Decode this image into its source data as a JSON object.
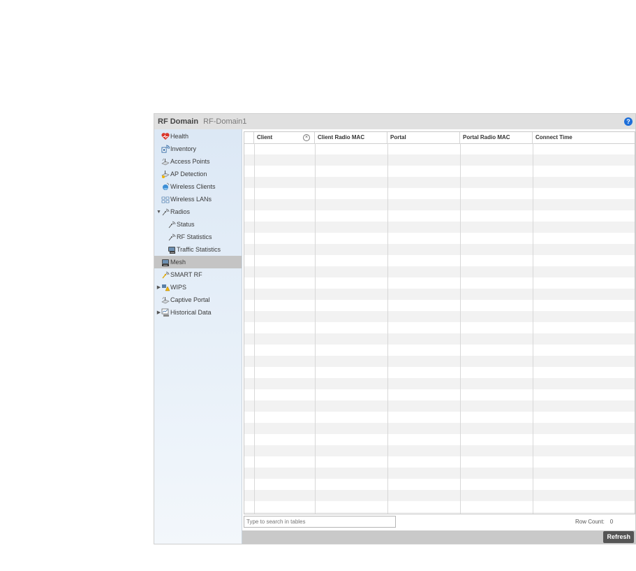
{
  "header": {
    "title": "RF Domain",
    "subtitle": "RF-Domain1",
    "help_icon": "help-icon"
  },
  "sidebar": {
    "items": [
      {
        "label": "Health",
        "icon": "health-icon"
      },
      {
        "label": "Inventory",
        "icon": "inventory-icon"
      },
      {
        "label": "Access Points",
        "icon": "access-points-icon"
      },
      {
        "label": "AP Detection",
        "icon": "ap-detection-icon"
      },
      {
        "label": "Wireless Clients",
        "icon": "wireless-clients-icon"
      },
      {
        "label": "Wireless LANs",
        "icon": "wireless-lans-icon"
      },
      {
        "label": "Radios",
        "icon": "radios-icon",
        "expanded": true
      },
      {
        "label": "Status",
        "icon": "radio-status-icon"
      },
      {
        "label": "RF Statistics",
        "icon": "rf-statistics-icon"
      },
      {
        "label": "Traffic Statistics",
        "icon": "traffic-statistics-icon"
      },
      {
        "label": "Mesh",
        "icon": "mesh-icon",
        "selected": true
      },
      {
        "label": "SMART RF",
        "icon": "smart-rf-icon"
      },
      {
        "label": "WIPS",
        "icon": "wips-icon",
        "collapsed": true
      },
      {
        "label": "Captive Portal",
        "icon": "captive-portal-icon"
      },
      {
        "label": "Historical Data",
        "icon": "historical-data-icon",
        "collapsed": true
      }
    ]
  },
  "table": {
    "columns": [
      "Client",
      "Client Radio MAC",
      "Portal",
      "Portal Radio MAC",
      "Connect Time"
    ],
    "rows": []
  },
  "search": {
    "placeholder": "Type to search in tables"
  },
  "row_count": {
    "label": "Row Count:",
    "value": "0"
  },
  "actions": {
    "refresh_label": "Refresh"
  },
  "colors": {
    "selected_row": "#c4c4c4",
    "stripe_row": "#f2f2f2",
    "help_blue": "#1e6fd9",
    "refresh_bg": "#555555"
  }
}
